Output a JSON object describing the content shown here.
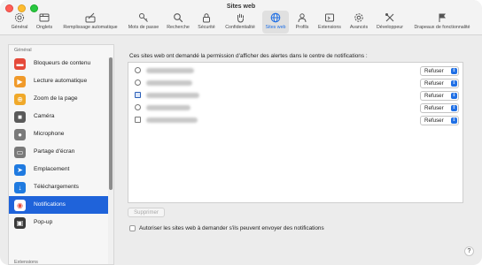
{
  "window": {
    "title": "Sites web"
  },
  "toolbar": {
    "items": [
      {
        "label": "Général",
        "icon": "gear-icon"
      },
      {
        "label": "Onglets",
        "icon": "tabs-icon"
      },
      {
        "label": "Remplissage automatique",
        "icon": "autofill-icon"
      },
      {
        "label": "Mots de passe",
        "icon": "key-icon"
      },
      {
        "label": "Recherche",
        "icon": "search-icon"
      },
      {
        "label": "Sécurité",
        "icon": "lock-icon"
      },
      {
        "label": "Confidentialité",
        "icon": "hand-icon"
      },
      {
        "label": "Sites web",
        "icon": "globe-icon"
      },
      {
        "label": "Profils",
        "icon": "profile-icon"
      },
      {
        "label": "Extensions",
        "icon": "extensions-icon"
      },
      {
        "label": "Avancés",
        "icon": "advanced-gear-icon"
      },
      {
        "label": "Développeur",
        "icon": "developer-tools-icon"
      },
      {
        "label": "Drapeaux de fonctionnalité",
        "icon": "flags-icon"
      }
    ],
    "active_index": 7,
    "accent_color": "#1f6fe5"
  },
  "sidebar": {
    "section_general": "Général",
    "section_extensions": "Extensions",
    "items": [
      {
        "label": "Bloqueurs de contenu",
        "icon": "content-blocker-icon",
        "color": "#e5493a"
      },
      {
        "label": "Lecture automatique",
        "icon": "play-icon",
        "color": "#f09a2a"
      },
      {
        "label": "Zoom de la page",
        "icon": "zoom-icon",
        "color": "#f0a92a"
      },
      {
        "label": "Caméra",
        "icon": "camera-icon",
        "color": "#5a5a5a"
      },
      {
        "label": "Microphone",
        "icon": "microphone-icon",
        "color": "#7a7a7a"
      },
      {
        "label": "Partage d'écran",
        "icon": "screen-share-icon",
        "color": "#7a7a7a"
      },
      {
        "label": "Emplacement",
        "icon": "location-icon",
        "color": "#1f7ae0"
      },
      {
        "label": "Téléchargements",
        "icon": "download-icon",
        "color": "#1f7ae0"
      },
      {
        "label": "Notifications",
        "icon": "notification-icon",
        "color": "#e5493a"
      },
      {
        "label": "Pop-up",
        "icon": "popup-icon",
        "color": "#3a3a3a"
      }
    ],
    "selected_index": 8,
    "selected_color": "#1f63da"
  },
  "main": {
    "title": "Ces sites web ont demandé la permission d'afficher des alertes dans le centre de notifications :",
    "sites": [
      {
        "permission": "Refuser"
      },
      {
        "permission": "Refuser"
      },
      {
        "permission": "Refuser"
      },
      {
        "permission": "Refuser"
      },
      {
        "permission": "Refuser"
      }
    ],
    "remove_button": "Supprimer",
    "allow_checkbox_label": "Autoriser les sites web à demander s'ils peuvent envoyer des notifications",
    "allow_checkbox_checked": false,
    "help_label": "?"
  }
}
